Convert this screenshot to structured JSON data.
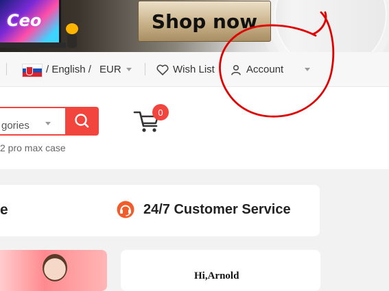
{
  "banner": {
    "laptop_text": "Ceo",
    "shop_now_label": "Shop now"
  },
  "topnav": {
    "language": "/ English /",
    "currency": "EUR",
    "wishlist_label": "Wish List",
    "account_label": "Account",
    "icons": [
      "flag-slovakia-icon",
      "heart-icon",
      "user-icon",
      "chevron-down-icon"
    ]
  },
  "search": {
    "category_text": "gories",
    "hint_text": "2 pro max case",
    "icons": [
      "search-icon",
      "chevron-down-icon"
    ]
  },
  "cart": {
    "count": "0",
    "icon": "cart-icon"
  },
  "service": {
    "left_text": "e",
    "right_text": "24/7 Customer Service",
    "icon": "headset-icon"
  },
  "greeting": {
    "text": "Hi,Arnold"
  },
  "colors": {
    "accent": "#f2453d",
    "annotation": "#e00000",
    "page_bg": "#f2f2f2"
  }
}
